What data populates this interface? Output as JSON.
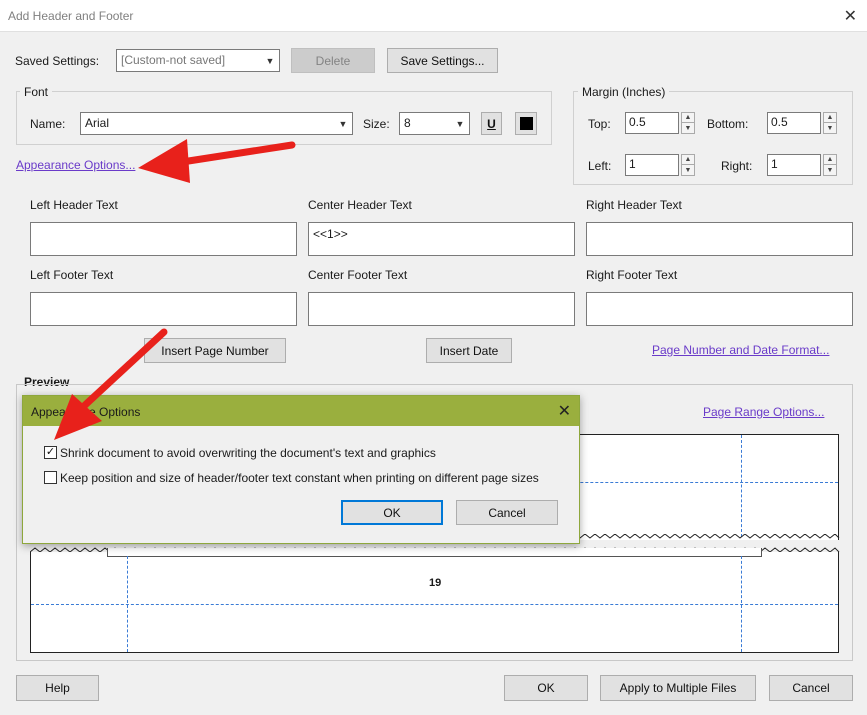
{
  "window": {
    "title": "Add Header and Footer"
  },
  "saved_settings": {
    "label": "Saved Settings:",
    "value": "[Custom-not saved]",
    "delete_label": "Delete",
    "save_label": "Save Settings..."
  },
  "font": {
    "group_label": "Font",
    "name_label": "Name:",
    "name_value": "Arial",
    "size_label": "Size:",
    "size_value": "8",
    "underline_glyph": "U"
  },
  "appearance_link": "Appearance Options...",
  "margin": {
    "group_label": "Margin (Inches)",
    "top_label": "Top:",
    "top_value": "0.5",
    "bottom_label": "Bottom:",
    "bottom_value": "0.5",
    "left_label": "Left:",
    "left_value": "1",
    "right_label": "Right:",
    "right_value": "1"
  },
  "header_footer": {
    "left_header_label": "Left Header Text",
    "center_header_label": "Center Header Text",
    "right_header_label": "Right Header Text",
    "left_footer_label": "Left Footer Text",
    "center_footer_label": "Center Footer Text",
    "right_footer_label": "Right Footer Text",
    "left_header_value": "",
    "center_header_value": "<<1>>",
    "right_header_value": "",
    "left_footer_value": "",
    "center_footer_value": "",
    "right_footer_value": ""
  },
  "insert_page_number": "Insert Page Number",
  "insert_date": "Insert Date",
  "page_number_format_link": "Page Number and Date Format...",
  "preview": {
    "label": "Preview",
    "page_range_link": "Page Range Options...",
    "page_number": "19"
  },
  "popup": {
    "title": "Appearance Options",
    "option1_label": "Shrink document to avoid overwriting  the document's text and graphics",
    "option1_checked": true,
    "option2_label": "Keep position and size of header/footer text constant when printing on different page sizes",
    "option2_checked": false,
    "ok_label": "OK",
    "cancel_label": "Cancel"
  },
  "footer_buttons": {
    "help": "Help",
    "ok": "OK",
    "apply_multiple": "Apply to Multiple Files",
    "cancel": "Cancel"
  },
  "colors": {
    "arrow": "#e8211b",
    "popup_title_bar": "#9aaf3e",
    "link": "#6a3bc9",
    "guide": "#3a7bd5"
  }
}
